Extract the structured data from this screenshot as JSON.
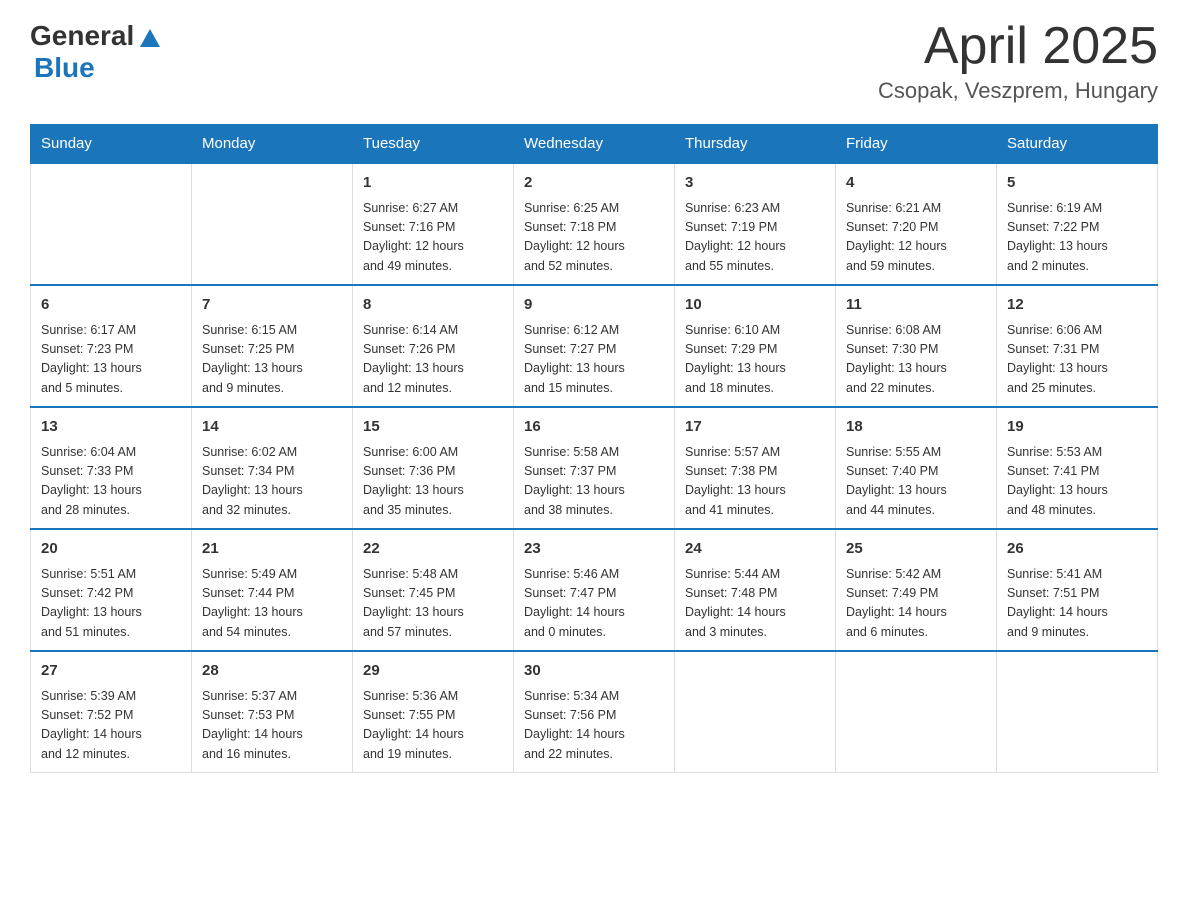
{
  "header": {
    "logo_general": "General",
    "logo_blue": "Blue",
    "title": "April 2025",
    "subtitle": "Csopak, Veszprem, Hungary"
  },
  "calendar": {
    "days": [
      "Sunday",
      "Monday",
      "Tuesday",
      "Wednesday",
      "Thursday",
      "Friday",
      "Saturday"
    ],
    "weeks": [
      [
        {
          "day": "",
          "info": ""
        },
        {
          "day": "",
          "info": ""
        },
        {
          "day": "1",
          "info": "Sunrise: 6:27 AM\nSunset: 7:16 PM\nDaylight: 12 hours\nand 49 minutes."
        },
        {
          "day": "2",
          "info": "Sunrise: 6:25 AM\nSunset: 7:18 PM\nDaylight: 12 hours\nand 52 minutes."
        },
        {
          "day": "3",
          "info": "Sunrise: 6:23 AM\nSunset: 7:19 PM\nDaylight: 12 hours\nand 55 minutes."
        },
        {
          "day": "4",
          "info": "Sunrise: 6:21 AM\nSunset: 7:20 PM\nDaylight: 12 hours\nand 59 minutes."
        },
        {
          "day": "5",
          "info": "Sunrise: 6:19 AM\nSunset: 7:22 PM\nDaylight: 13 hours\nand 2 minutes."
        }
      ],
      [
        {
          "day": "6",
          "info": "Sunrise: 6:17 AM\nSunset: 7:23 PM\nDaylight: 13 hours\nand 5 minutes."
        },
        {
          "day": "7",
          "info": "Sunrise: 6:15 AM\nSunset: 7:25 PM\nDaylight: 13 hours\nand 9 minutes."
        },
        {
          "day": "8",
          "info": "Sunrise: 6:14 AM\nSunset: 7:26 PM\nDaylight: 13 hours\nand 12 minutes."
        },
        {
          "day": "9",
          "info": "Sunrise: 6:12 AM\nSunset: 7:27 PM\nDaylight: 13 hours\nand 15 minutes."
        },
        {
          "day": "10",
          "info": "Sunrise: 6:10 AM\nSunset: 7:29 PM\nDaylight: 13 hours\nand 18 minutes."
        },
        {
          "day": "11",
          "info": "Sunrise: 6:08 AM\nSunset: 7:30 PM\nDaylight: 13 hours\nand 22 minutes."
        },
        {
          "day": "12",
          "info": "Sunrise: 6:06 AM\nSunset: 7:31 PM\nDaylight: 13 hours\nand 25 minutes."
        }
      ],
      [
        {
          "day": "13",
          "info": "Sunrise: 6:04 AM\nSunset: 7:33 PM\nDaylight: 13 hours\nand 28 minutes."
        },
        {
          "day": "14",
          "info": "Sunrise: 6:02 AM\nSunset: 7:34 PM\nDaylight: 13 hours\nand 32 minutes."
        },
        {
          "day": "15",
          "info": "Sunrise: 6:00 AM\nSunset: 7:36 PM\nDaylight: 13 hours\nand 35 minutes."
        },
        {
          "day": "16",
          "info": "Sunrise: 5:58 AM\nSunset: 7:37 PM\nDaylight: 13 hours\nand 38 minutes."
        },
        {
          "day": "17",
          "info": "Sunrise: 5:57 AM\nSunset: 7:38 PM\nDaylight: 13 hours\nand 41 minutes."
        },
        {
          "day": "18",
          "info": "Sunrise: 5:55 AM\nSunset: 7:40 PM\nDaylight: 13 hours\nand 44 minutes."
        },
        {
          "day": "19",
          "info": "Sunrise: 5:53 AM\nSunset: 7:41 PM\nDaylight: 13 hours\nand 48 minutes."
        }
      ],
      [
        {
          "day": "20",
          "info": "Sunrise: 5:51 AM\nSunset: 7:42 PM\nDaylight: 13 hours\nand 51 minutes."
        },
        {
          "day": "21",
          "info": "Sunrise: 5:49 AM\nSunset: 7:44 PM\nDaylight: 13 hours\nand 54 minutes."
        },
        {
          "day": "22",
          "info": "Sunrise: 5:48 AM\nSunset: 7:45 PM\nDaylight: 13 hours\nand 57 minutes."
        },
        {
          "day": "23",
          "info": "Sunrise: 5:46 AM\nSunset: 7:47 PM\nDaylight: 14 hours\nand 0 minutes."
        },
        {
          "day": "24",
          "info": "Sunrise: 5:44 AM\nSunset: 7:48 PM\nDaylight: 14 hours\nand 3 minutes."
        },
        {
          "day": "25",
          "info": "Sunrise: 5:42 AM\nSunset: 7:49 PM\nDaylight: 14 hours\nand 6 minutes."
        },
        {
          "day": "26",
          "info": "Sunrise: 5:41 AM\nSunset: 7:51 PM\nDaylight: 14 hours\nand 9 minutes."
        }
      ],
      [
        {
          "day": "27",
          "info": "Sunrise: 5:39 AM\nSunset: 7:52 PM\nDaylight: 14 hours\nand 12 minutes."
        },
        {
          "day": "28",
          "info": "Sunrise: 5:37 AM\nSunset: 7:53 PM\nDaylight: 14 hours\nand 16 minutes."
        },
        {
          "day": "29",
          "info": "Sunrise: 5:36 AM\nSunset: 7:55 PM\nDaylight: 14 hours\nand 19 minutes."
        },
        {
          "day": "30",
          "info": "Sunrise: 5:34 AM\nSunset: 7:56 PM\nDaylight: 14 hours\nand 22 minutes."
        },
        {
          "day": "",
          "info": ""
        },
        {
          "day": "",
          "info": ""
        },
        {
          "day": "",
          "info": ""
        }
      ]
    ]
  }
}
